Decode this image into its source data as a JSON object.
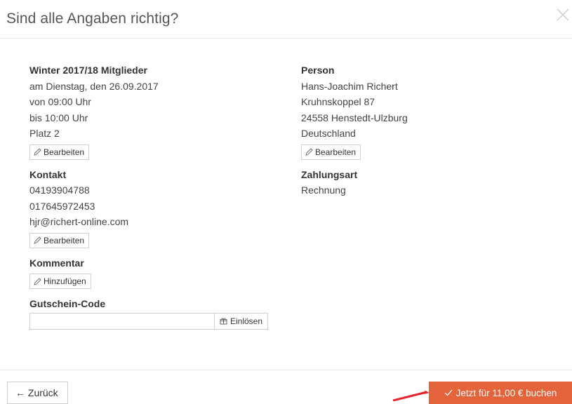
{
  "dialog": {
    "title": "Sind alle Angaben richtig?",
    "close_icon": "close-icon"
  },
  "booking": {
    "heading": "Winter 2017/18 Mitglieder",
    "date": "am Dienstag, den 26.09.2017",
    "from": "von 09:00 Uhr",
    "to": "bis 10:00 Uhr",
    "place": "Platz 2",
    "edit_label": "Bearbeiten"
  },
  "contact": {
    "heading": "Kontakt",
    "phone1": "04193904788",
    "phone2": "017645972453",
    "email": "hjr@richert-online.com",
    "edit_label": "Bearbeiten"
  },
  "comment": {
    "heading": "Kommentar",
    "add_label": "Hinzufügen"
  },
  "coupon": {
    "heading": "Gutschein-Code",
    "value": "",
    "redeem_label": "Einlösen"
  },
  "person": {
    "heading": "Person",
    "name": "Hans-Joachim Richert",
    "street": "Kruhnskoppel 87",
    "city": "24558 Henstedt-Ulzburg",
    "country": "Deutschland",
    "edit_label": "Bearbeiten"
  },
  "payment": {
    "heading": "Zahlungsart",
    "method": "Rechnung"
  },
  "footer": {
    "back_label": "← Zurück",
    "book_label": "Jetzt für 11,00 € buchen"
  },
  "colors": {
    "accent": "#e4633b",
    "annotation_arrow": "#e8212b"
  }
}
